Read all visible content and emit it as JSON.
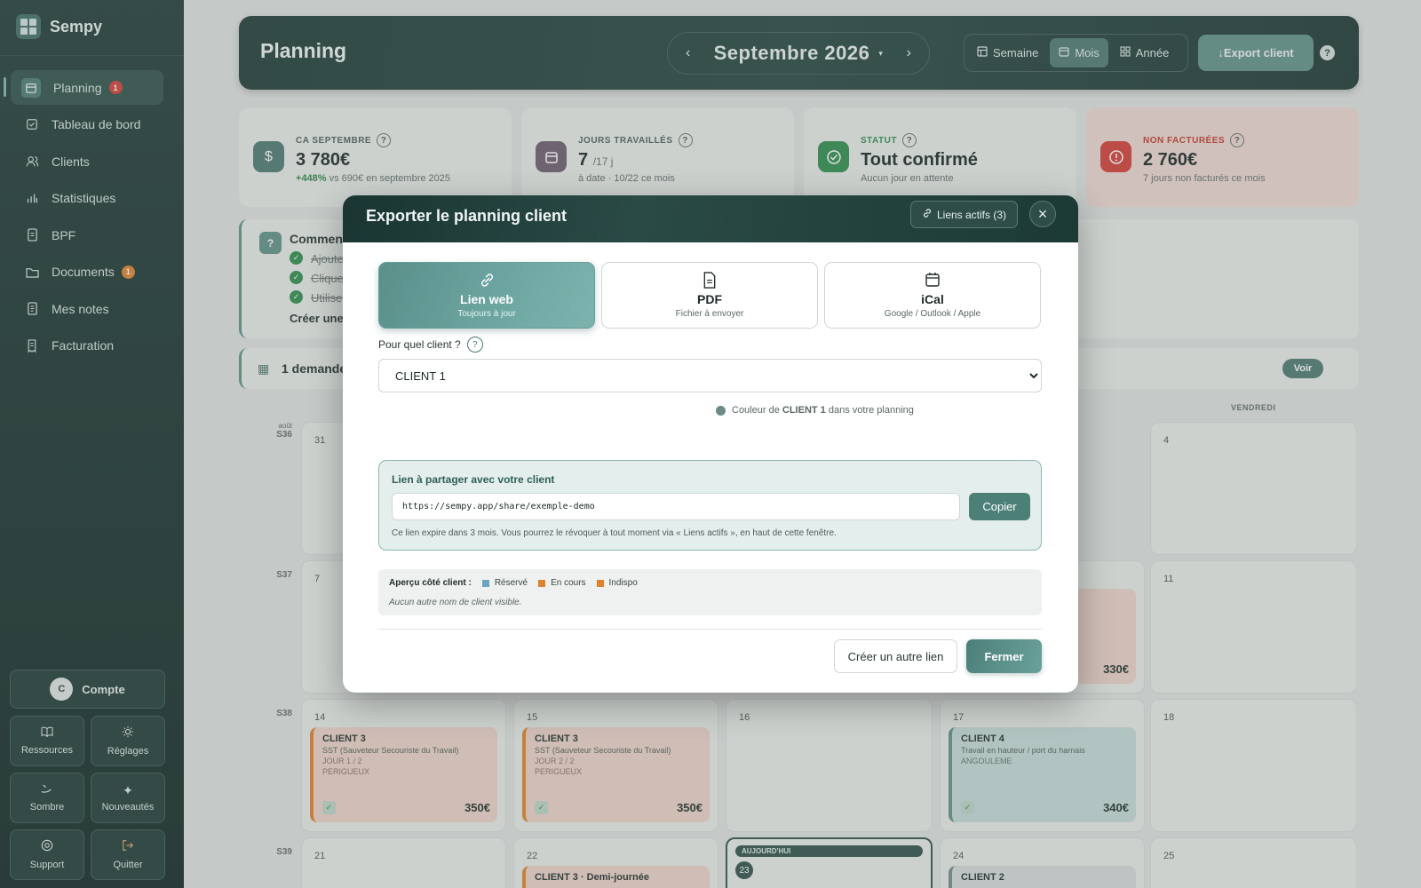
{
  "app": {
    "name": "Sempy"
  },
  "sidebar": {
    "items": [
      {
        "label": "Planning",
        "badge": "1",
        "icon": "calendar-icon"
      },
      {
        "label": "Tableau de bord",
        "icon": "checkbox-icon"
      },
      {
        "label": "Clients",
        "icon": "users-icon"
      },
      {
        "label": "Statistiques",
        "icon": "bar-chart-icon"
      },
      {
        "label": "BPF",
        "icon": "document-icon"
      },
      {
        "label": "Documents",
        "badge": "1",
        "icon": "folder-icon"
      },
      {
        "label": "Mes notes",
        "icon": "notes-icon"
      },
      {
        "label": "Facturation",
        "icon": "receipt-icon"
      }
    ],
    "account": {
      "avatar": "C",
      "label": "Compte"
    },
    "tiles": [
      {
        "label": "Ressources",
        "icon": "book-icon"
      },
      {
        "label": "Réglages",
        "icon": "settings-icon"
      },
      {
        "label": "Sombre",
        "icon": "moon-icon"
      },
      {
        "label": "Nouveautés",
        "icon": "sparkles-icon"
      },
      {
        "label": "Support",
        "icon": "lifebuoy-icon"
      },
      {
        "label": "Quitter",
        "icon": "logout-icon"
      }
    ]
  },
  "header": {
    "title": "Planning",
    "month": "Septembre 2026",
    "views": [
      "Semaine",
      "Mois",
      "Année"
    ],
    "active_view": "Mois",
    "export_label": "↓Export client",
    "help": "?"
  },
  "stats": [
    {
      "label": "CA SEPTEMBRE",
      "value": "3 780€",
      "unit": "",
      "sub_highlight": "+448%",
      "sub": "vs 690€ en septembre 2025",
      "color": "#4d7771",
      "icon": "dollar-icon"
    },
    {
      "label": "JOURS TRAVAILLÉS",
      "value": "7",
      "unit": "/17 j",
      "sub_highlight": "",
      "sub": "à date · 10/22 ce mois",
      "color": "#6b5a6e",
      "icon": "calendar-icon"
    },
    {
      "label": "STATUT",
      "value": "Tout confirmé",
      "unit": "",
      "sub_highlight": "",
      "sub": "Aucun jour en attente",
      "color": "#2d8b4d",
      "icon": "check-circle-icon"
    },
    {
      "label": "NON FACTURÉES",
      "value": "2 760€",
      "unit": "",
      "sub_highlight": "",
      "sub": "7 jours non facturés ce mois",
      "color": "#d23b35",
      "icon": "alert-icon"
    }
  ],
  "help_panel": {
    "title": "Comment",
    "items": [
      "Ajouter",
      "Cliquer",
      "Utiliser"
    ],
    "create": "Créer une s"
  },
  "request_bar": {
    "text": "1 demande",
    "button": "Voir"
  },
  "calendar": {
    "day_header": "VENDREDI",
    "weeks": [
      {
        "label": "S36",
        "month": "août",
        "days": [
          "31",
          "",
          "",
          "",
          "4"
        ]
      },
      {
        "label": "S37",
        "month": "",
        "days": [
          "7",
          "",
          "",
          "",
          "11"
        ]
      },
      {
        "label": "S38",
        "month": "",
        "days": [
          "14",
          "15",
          "16",
          "17",
          "18"
        ]
      },
      {
        "label": "S39",
        "month": "",
        "days": [
          "21",
          "22",
          "23",
          "24",
          "25"
        ]
      }
    ],
    "today_label": "AUJOURD'HUI",
    "events": [
      {
        "title": "CLIENT 3",
        "sub": "SST (Sauveteur Secouriste du Travail)",
        "meta1": "JOUR 1 / 2",
        "meta2": "PERIGUEUX",
        "price": "350€"
      },
      {
        "title": "CLIENT 3",
        "sub": "SST (Sauveteur Secouriste du Travail)",
        "meta1": "JOUR 2 / 2",
        "meta2": "PERIGUEUX",
        "price": "350€"
      },
      {
        "title": "CLIENT 4",
        "sub": "Travail en hauteur / port du harnais",
        "meta1": "ANGOULEME",
        "meta2": "",
        "price": "340€"
      },
      {
        "title": "CLIENT 3 · Demi-journée"
      },
      {
        "title": "CLIENT 2"
      }
    ],
    "partial_price": "330€"
  },
  "modal": {
    "title": "Exporter le planning client",
    "links_button": "Liens actifs (3)",
    "options": [
      {
        "label": "Lien web",
        "sub": "Toujours à jour",
        "icon": "link-icon"
      },
      {
        "label": "PDF",
        "sub": "Fichier à envoyer",
        "icon": "file-icon"
      },
      {
        "label": "iCal",
        "sub": "Google / Outlook / Apple",
        "icon": "calendar-icon"
      }
    ],
    "client_question": "Pour quel client ?",
    "client_options": [
      "CLIENT 1"
    ],
    "client_selected": "CLIENT 1",
    "color_note_prefix": "Couleur de",
    "color_note_client": "CLIENT 1",
    "color_note_suffix": "dans votre planning",
    "share": {
      "title": "Lien à partager avec votre client",
      "url": "https://sempy.app/share/exemple-demo",
      "copy": "Copier",
      "note": "Ce lien expire dans 3 mois. Vous pourrez le révoquer à tout moment via « Liens actifs », en haut de cette fenêtre."
    },
    "preview": {
      "label": "Aperçu côté client :",
      "legend": [
        {
          "label": "Réservé",
          "color": "#6aa6c2"
        },
        {
          "label": "En cours",
          "color": "#e0812c"
        },
        {
          "label": "Indispo",
          "color": "#e0812c"
        }
      ],
      "note": "Aucun autre nom de client visible."
    },
    "secondary_button": "Créer un autre lien",
    "primary_button": "Fermer"
  }
}
